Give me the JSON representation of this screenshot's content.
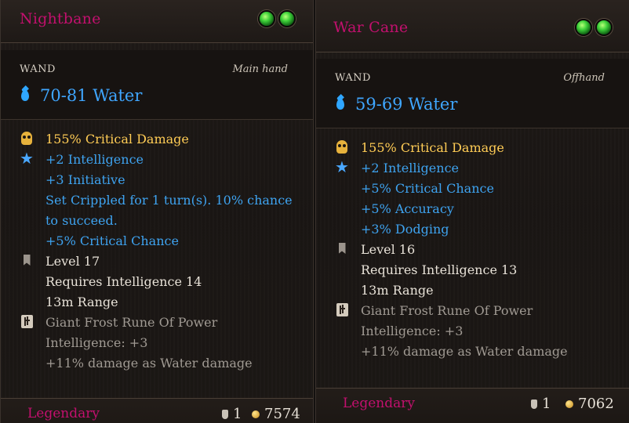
{
  "left": {
    "name": "Nightbane",
    "type": "WAND",
    "hand": "Main hand",
    "damage": "70-81 Water",
    "props": [
      {
        "icon": "skull-icon",
        "text": "155% Critical Damage",
        "color": "gold"
      },
      {
        "icon": "star-icon",
        "text": "+2 Intelligence",
        "color": "blue"
      },
      {
        "icon": "",
        "text": "+3 Initiative",
        "color": "blue"
      },
      {
        "icon": "",
        "text": "Set Crippled for 1 turn(s). 10% chance",
        "color": "blue"
      },
      {
        "icon": "",
        "text": "to succeed.",
        "color": "blue"
      },
      {
        "icon": "",
        "text": "+5% Critical Chance",
        "color": "blue"
      },
      {
        "icon": "bookmark-icon",
        "text": "Level 17",
        "color": "white"
      },
      {
        "icon": "",
        "text": "Requires Intelligence 14",
        "color": "white"
      },
      {
        "icon": "",
        "text": "13m Range",
        "color": "white"
      },
      {
        "icon": "rune-icon",
        "text": "Giant Frost Rune Of Power",
        "color": "grey"
      },
      {
        "icon": "",
        "text": "Intelligence: +3",
        "color": "grey"
      },
      {
        "icon": "",
        "text": "+11% damage as Water damage",
        "color": "grey"
      }
    ],
    "rarity": "Legendary",
    "weight": "1",
    "price": "7574"
  },
  "right": {
    "name": "War Cane",
    "type": "WAND",
    "hand": "Offhand",
    "damage": "59-69 Water",
    "props": [
      {
        "icon": "skull-icon",
        "text": "155% Critical Damage",
        "color": "gold"
      },
      {
        "icon": "star-icon",
        "text": "+2 Intelligence",
        "color": "blue"
      },
      {
        "icon": "",
        "text": "+5% Critical Chance",
        "color": "blue"
      },
      {
        "icon": "",
        "text": "+5% Accuracy",
        "color": "blue"
      },
      {
        "icon": "",
        "text": "+3% Dodging",
        "color": "blue"
      },
      {
        "icon": "bookmark-icon",
        "text": "Level 16",
        "color": "white"
      },
      {
        "icon": "",
        "text": "Requires Intelligence 13",
        "color": "white"
      },
      {
        "icon": "",
        "text": "13m Range",
        "color": "white"
      },
      {
        "icon": "rune-icon",
        "text": "Giant Frost Rune Of Power",
        "color": "grey"
      },
      {
        "icon": "",
        "text": "Intelligence: +3",
        "color": "grey"
      },
      {
        "icon": "",
        "text": "+11% damage as Water damage",
        "color": "grey"
      }
    ],
    "rarity": "Legendary",
    "weight": "1",
    "price": "7062"
  },
  "colors": {
    "rarity": "#c2106e",
    "stat_blue": "#3ea3f0",
    "crit_gold": "#ffcc55",
    "water": "#3fa6ff"
  }
}
